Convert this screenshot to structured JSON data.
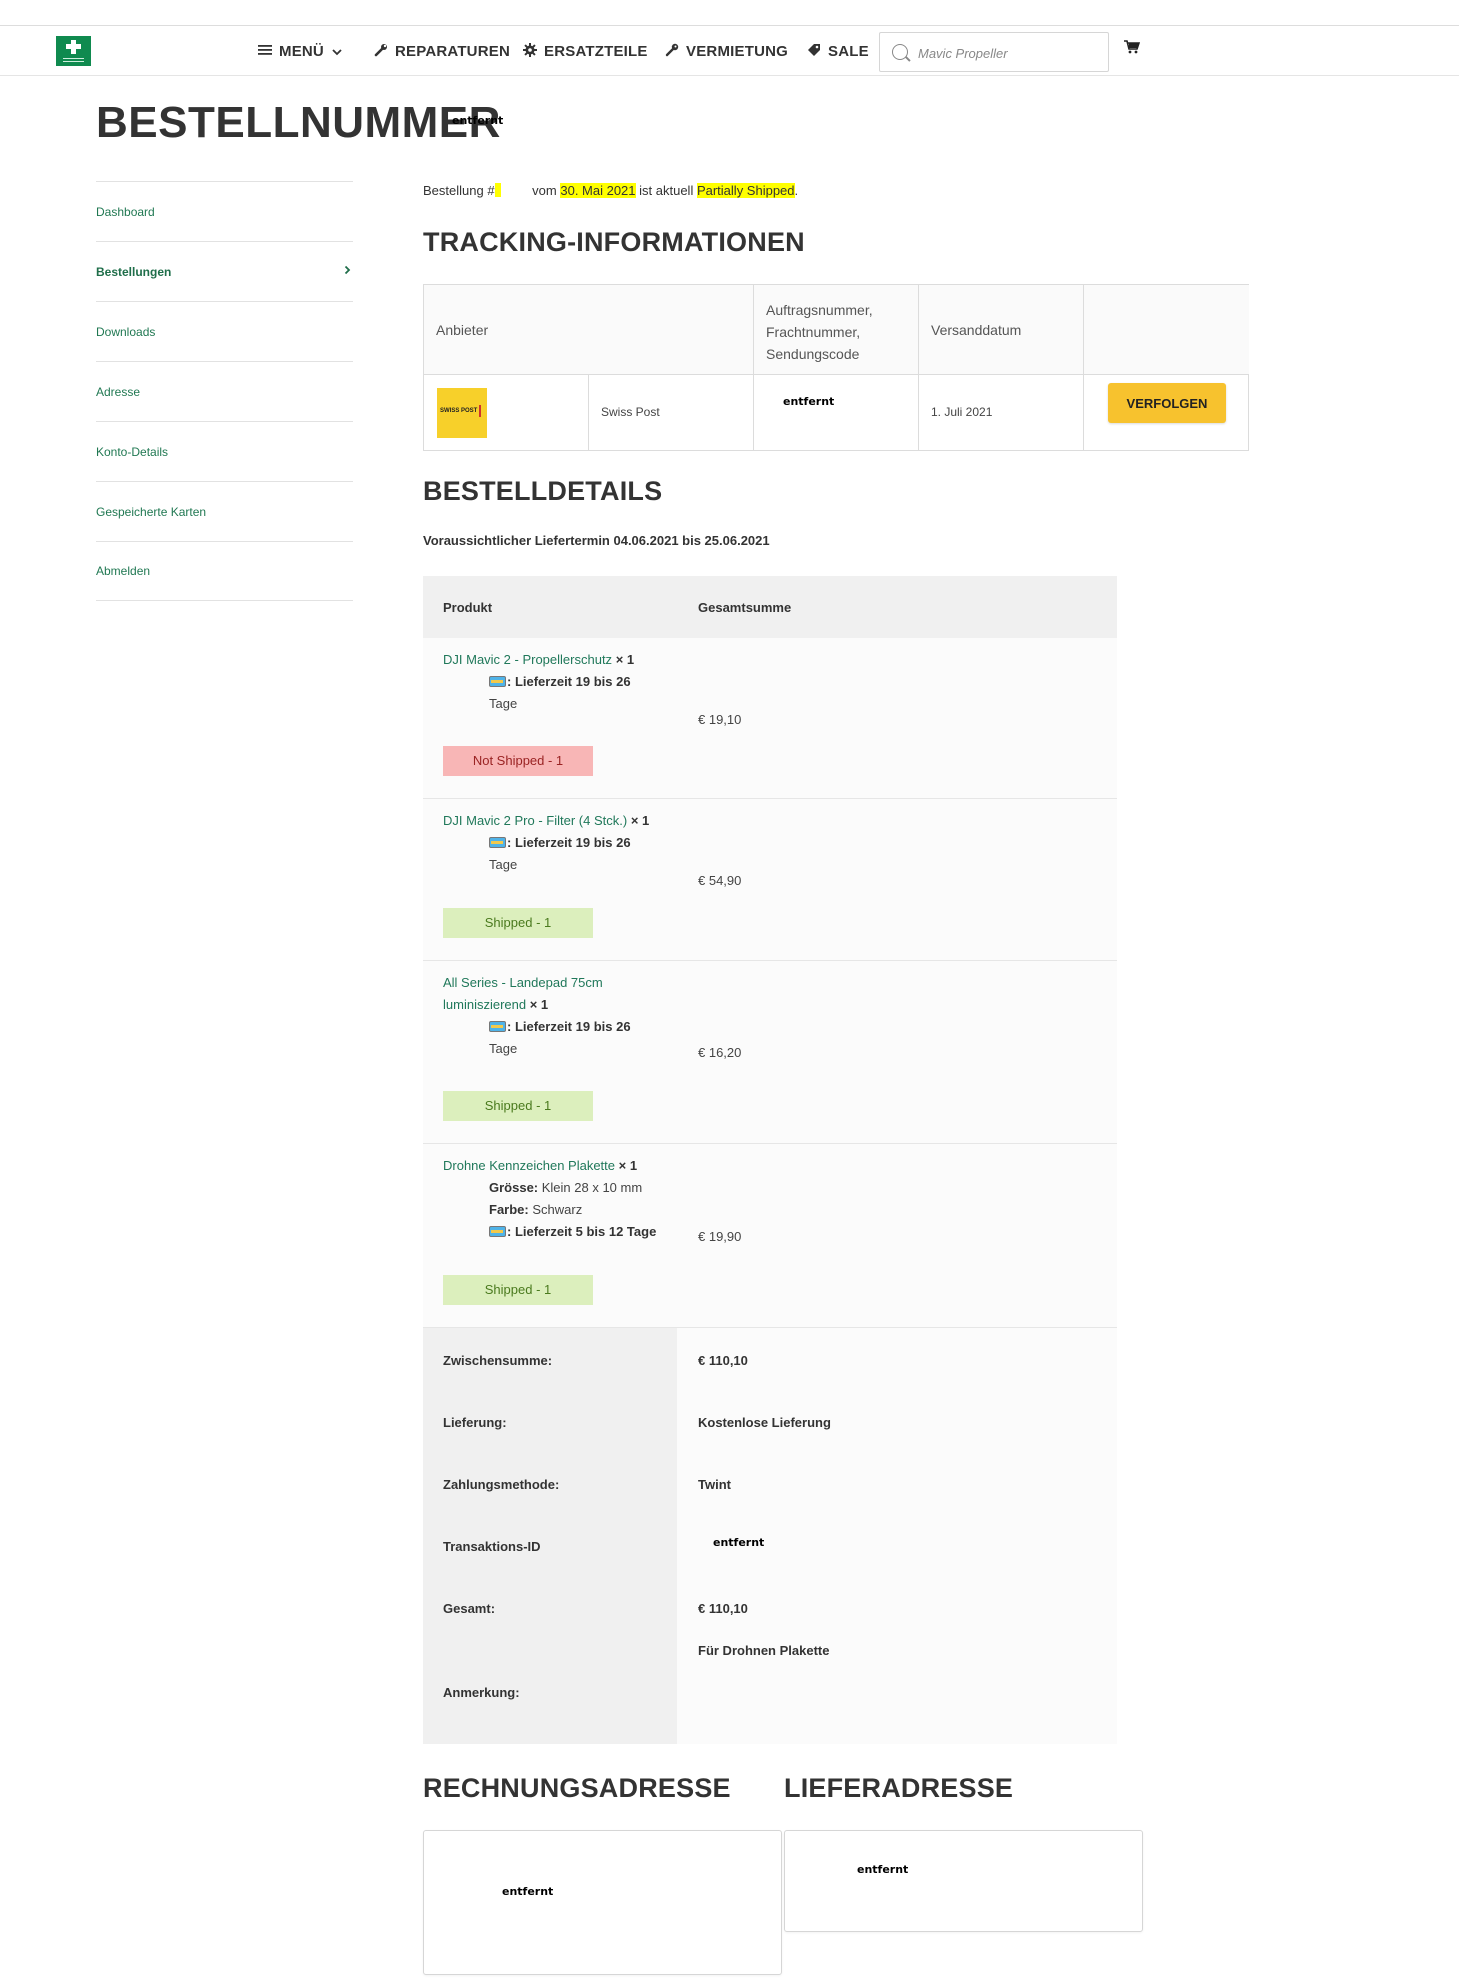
{
  "header": {
    "logo_icon": "green-cross-logo",
    "nav": {
      "menu": "MENÜ",
      "reparaturen": "REPARATUREN",
      "ersatzteile": "ERSATZTEILE",
      "vermietung": "VERMIETUNG",
      "sale": "SALE"
    },
    "search_placeholder": "Mavic Propeller"
  },
  "page": {
    "title": "BESTELLNUMMER",
    "redacted": "entfernt"
  },
  "sidebar": {
    "items": [
      {
        "label": "Dashboard"
      },
      {
        "label": "Bestellungen"
      },
      {
        "label": "Downloads"
      },
      {
        "label": "Adresse"
      },
      {
        "label": "Konto-Details"
      },
      {
        "label": "Gespeicherte Karten"
      },
      {
        "label": "Abmelden"
      }
    ]
  },
  "status": {
    "prefix": "Bestellung #",
    "middle": " vom ",
    "date": "30. Mai 2021",
    "mid2": " ist aktuell ",
    "state": "Partially Shipped",
    "suffix": "."
  },
  "tracking": {
    "heading": "TRACKING-INFORMATIONEN",
    "col_provider": "Anbieter",
    "col_number_1": "Auftragsnummer,",
    "col_number_2": "Frachtnummer,",
    "col_number_3": "Sendungscode",
    "col_date": "Versanddatum",
    "provider_logo_text": "SWISS POST",
    "provider_name": "Swiss Post",
    "tracking_code": "entfernt",
    "ship_date": "1. Juli 2021",
    "button": "VERFOLGEN"
  },
  "details": {
    "heading": "BESTELLDETAILS",
    "delivery_estimate": "Voraussichtlicher Liefertermin 04.06.2021 bis 25.06.2021",
    "col_product": "Produkt",
    "col_total": "Gesamtsumme",
    "items": [
      {
        "name": "DJI Mavic 2 - Propellerschutz",
        "qty": "× 1",
        "lead_1": ": Lieferzeit 19 bis 26",
        "lead_2": "Tage",
        "price": "€ 19,10",
        "status": "Not Shipped - 1"
      },
      {
        "name": "DJI Mavic 2 Pro - Filter (4 Stck.)",
        "qty": "× 1",
        "lead_1": ": Lieferzeit 19 bis 26",
        "lead_2": "Tage",
        "price": "€ 54,90",
        "status": "Shipped - 1"
      },
      {
        "name_1": "All Series - Landepad 75cm",
        "name_2": "luminiszierend",
        "qty": "× 1",
        "lead_1": ": Lieferzeit 19 bis 26",
        "lead_2": "Tage",
        "price": "€ 16,20",
        "status": "Shipped - 1"
      },
      {
        "name": "Drohne Kennzeichen Plakette",
        "qty": "× 1",
        "size_label": "Grösse:",
        "size_value": " Klein 28 x 10 mm",
        "color_label": "Farbe:",
        "color_value": " Schwarz",
        "lead": ": Lieferzeit 5 bis 12 Tage",
        "price": "€ 19,90",
        "status": "Shipped - 1"
      }
    ],
    "totals": [
      {
        "label": "Zwischensumme:",
        "value": "€ 110,10"
      },
      {
        "label": "Lieferung:",
        "value": "Kostenlose Lieferung"
      },
      {
        "label": "Zahlungsmethode:",
        "value": "Twint"
      },
      {
        "label": "Transaktions-ID",
        "value": "entfernt"
      },
      {
        "label": "Gesamt:",
        "value": "€ 110,10"
      },
      {
        "label": "Anmerkung:",
        "value": "Für Drohnen Plakette"
      }
    ]
  },
  "addresses": {
    "billing_heading": "RECHNUNGSADRESSE",
    "shipping_heading": "LIEFERADRESSE",
    "billing_text": "entfernt",
    "shipping_text": "entfernt"
  }
}
